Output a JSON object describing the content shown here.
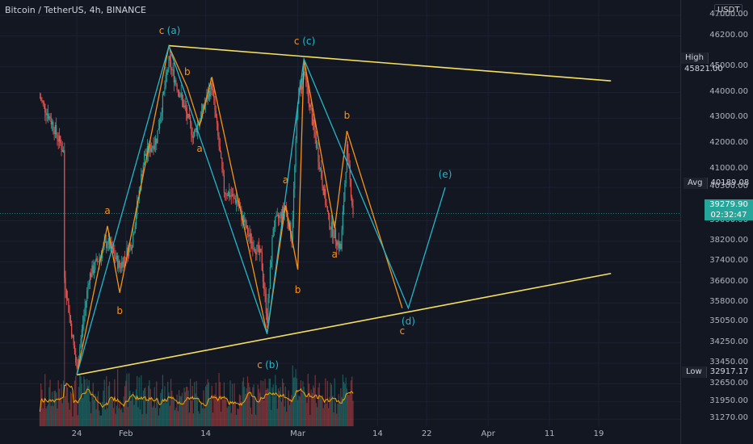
{
  "title": "Bitcoin / TetherUS, 4h, BINANCE",
  "currency": "USDT",
  "colors": {
    "background": "#131722",
    "up": "#26a69a",
    "down": "#ef5350",
    "trendline": "#f6e05e",
    "orange_wave": "#f7931a",
    "cyan_wave": "#26b6c9",
    "volume_ma": "#f7a600"
  },
  "tags": {
    "high": {
      "label": "High",
      "value": "45821.00"
    },
    "avg": {
      "label": "Avg",
      "value": "40189.08"
    },
    "low": {
      "label": "Low",
      "value": "32917.17"
    },
    "last": {
      "value": "39279.90",
      "countdown": "02:32:47"
    }
  },
  "chart_data": {
    "type": "line",
    "title": "Bitcoin / TetherUS, 4h, BINANCE",
    "yaxis_ticks": [
      "47000.00",
      "46200.00",
      "45000.00",
      "44000.00",
      "43000.00",
      "42000.00",
      "41000.00",
      "40300.00",
      "39000.00",
      "38200.00",
      "37400.00",
      "36600.00",
      "35800.00",
      "35050.00",
      "34250.00",
      "33450.00",
      "32650.00",
      "31950.00",
      "31270.00"
    ],
    "xaxis_ticks": [
      "24",
      "Feb",
      "14",
      "Mar",
      "14",
      "22",
      "Apr",
      "11",
      "19"
    ],
    "ylim": [
      31000,
      47600
    ],
    "grid": true,
    "trendlines": [
      {
        "name": "upper",
        "points": [
          [
            "Feb 8",
            45821
          ],
          [
            "Apr 21",
            44450
          ]
        ]
      },
      {
        "name": "lower",
        "points": [
          [
            "Jan 24",
            33000
          ],
          [
            "Apr 21",
            36950
          ]
        ]
      }
    ],
    "series": [
      {
        "name": "orange_wave",
        "points": [
          [
            "Jan 24",
            33000
          ],
          [
            "Jan 29",
            38800
          ],
          [
            "Jan 31",
            36200
          ],
          [
            "Feb 8",
            45800
          ],
          [
            "Feb 11",
            44200
          ],
          [
            "Feb 13",
            42700
          ],
          [
            "Feb 15",
            44600
          ],
          [
            "Feb 24",
            34600
          ],
          [
            "Feb 27",
            39600
          ],
          [
            "Mar 1",
            37100
          ],
          [
            "Mar 2",
            45300
          ],
          [
            "Mar 7",
            38700
          ],
          [
            "Mar 9",
            42500
          ],
          [
            "Mar 18",
            35600
          ]
        ]
      },
      {
        "name": "cyan_wave",
        "points": [
          [
            "Jan 24",
            33000
          ],
          [
            "Feb 8",
            45800
          ],
          [
            "Feb 24",
            34600
          ],
          [
            "Mar 2",
            45300
          ],
          [
            "Mar 19",
            35600
          ],
          [
            "Mar 25",
            40300
          ]
        ]
      }
    ],
    "wave_labels": [
      {
        "text": "c",
        "color": "orange",
        "x": "Feb 8",
        "y": 46400
      },
      {
        "text": "(a)",
        "color": "cyan",
        "x": "Feb 8",
        "y": 46400
      },
      {
        "text": "a",
        "color": "orange",
        "x": "Jan 29",
        "y": 39400
      },
      {
        "text": "b",
        "color": "orange",
        "x": "Jan 31",
        "y": 35500
      },
      {
        "text": "b",
        "color": "orange",
        "x": "Feb 11",
        "y": 44800
      },
      {
        "text": "a",
        "color": "orange",
        "x": "Feb 13",
        "y": 41800
      },
      {
        "text": "c",
        "color": "orange",
        "x": "Feb 24",
        "y": 33400
      },
      {
        "text": "(b)",
        "color": "cyan",
        "x": "Feb 24",
        "y": 33400
      },
      {
        "text": "a",
        "color": "orange",
        "x": "Feb 27",
        "y": 40600
      },
      {
        "text": "b",
        "color": "orange",
        "x": "Mar 1",
        "y": 36300
      },
      {
        "text": "c",
        "color": "orange",
        "x": "Mar 2",
        "y": 46000
      },
      {
        "text": "(c)",
        "color": "cyan",
        "x": "Mar 2",
        "y": 46000
      },
      {
        "text": "a",
        "color": "orange",
        "x": "Mar 7",
        "y": 37700
      },
      {
        "text": "b",
        "color": "orange",
        "x": "Mar 9",
        "y": 43100
      },
      {
        "text": "c",
        "color": "orange",
        "x": "Mar 18",
        "y": 34700
      },
      {
        "text": "(d)",
        "color": "cyan",
        "x": "Mar 19",
        "y": 35100
      },
      {
        "text": "(e)",
        "color": "cyan",
        "x": "Mar 25",
        "y": 40800
      }
    ],
    "price": {
      "start": "Jan 18",
      "end": "Mar 10",
      "anchors": [
        [
          "Jan 18",
          43800
        ],
        [
          "Jan 20",
          42800
        ],
        [
          "Jan 22",
          41600
        ],
        [
          "Jan 22",
          36800
        ],
        [
          "Jan 24",
          33200
        ],
        [
          "Jan 26",
          36800
        ],
        [
          "Jan 29",
          38200
        ],
        [
          "Jan 31",
          37200
        ],
        [
          "Feb 2",
          38200
        ],
        [
          "Feb 4",
          41500
        ],
        [
          "Feb 6",
          42200
        ],
        [
          "Feb 8",
          45200
        ],
        [
          "Feb 10",
          43800
        ],
        [
          "Feb 12",
          42300
        ],
        [
          "Feb 15",
          44300
        ],
        [
          "Feb 17",
          40200
        ],
        [
          "Feb 19",
          39800
        ],
        [
          "Feb 21",
          38400
        ],
        [
          "Feb 23",
          37600
        ],
        [
          "Feb 24",
          35200
        ],
        [
          "Feb 25",
          38800
        ],
        [
          "Feb 27",
          39500
        ],
        [
          "Feb 28",
          38300
        ],
        [
          "Mar 1",
          43800
        ],
        [
          "Mar 2",
          44800
        ],
        [
          "Mar 4",
          42000
        ],
        [
          "Mar 6",
          39000
        ],
        [
          "Mar 8",
          37900
        ],
        [
          "Mar 9",
          41800
        ],
        [
          "Mar 10",
          39300
        ]
      ]
    }
  }
}
